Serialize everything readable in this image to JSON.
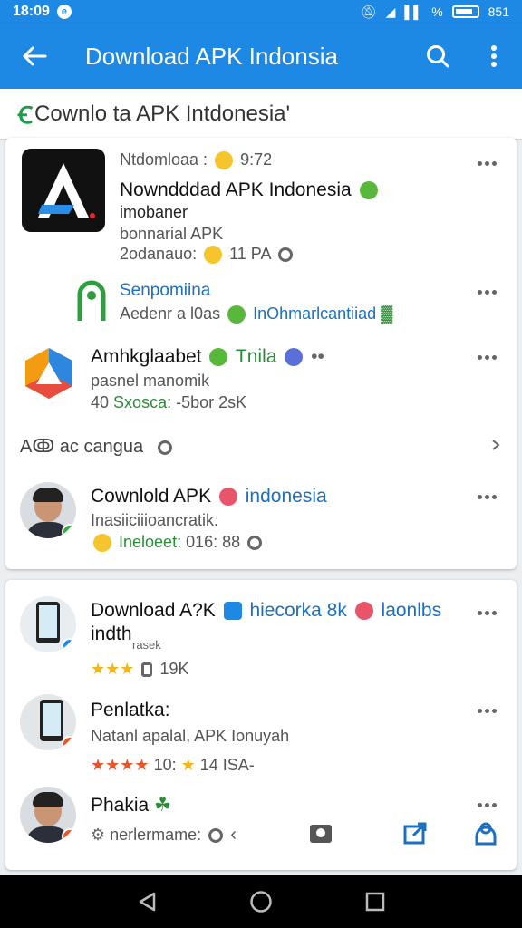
{
  "status_bar": {
    "time": "18:09",
    "battery": "%",
    "level_text": "851"
  },
  "app_bar": {
    "title": "Download APK Indonsia"
  },
  "sub_header": {
    "logo": "Ꞓ",
    "subtitle": "Cownlo ta APK Intdonesia'"
  },
  "card1": {
    "item1": {
      "meta_left": "Ntdomloaa :",
      "meta_right": "9:72",
      "title": "Nowndddad APK Indonesia",
      "line2": "imobaner",
      "line3": "bonnarial APK",
      "line4_left": "2odanauo:",
      "line4_right": "11 PA"
    },
    "item2": {
      "title": "Senpomiina",
      "line2_left": "Aedenr a l0as",
      "line2_right": "InOhmarlcantiiad"
    },
    "item3": {
      "title_left": "Amhkglaabet",
      "title_right": "Tnila",
      "line2": "pasnel manomik",
      "line3_num": "40",
      "line3_green": "Sxosca:",
      "line3_rest": "-5bor 2sK"
    },
    "section": {
      "label": "Aↂ ac cangua"
    },
    "item4": {
      "title_left": "Cownlold APK",
      "title_right": "indonesia",
      "line2": "Inasiiciiioancratik.",
      "line3_green": "Ineloeet:",
      "line3_rest": "016: 88"
    }
  },
  "card2": {
    "item1": {
      "title_left": "Download A?K",
      "title_blue": "hiecorka 8k",
      "title_blue2": "laonlbs",
      "title_line2": "indth",
      "small": "rasek",
      "rating_text": "19K"
    },
    "item2": {
      "title": "Penlatka:",
      "line2": "Natanl apalal, APK Ionuyah",
      "rating_num": "10:",
      "rating_rest": "14 ISA-"
    },
    "item3": {
      "title": "Phakia",
      "line2": "nerlermame:"
    }
  },
  "colors": {
    "primary": "#1e88e5",
    "green": "#2e8b3a",
    "star": "#f3b51b"
  }
}
